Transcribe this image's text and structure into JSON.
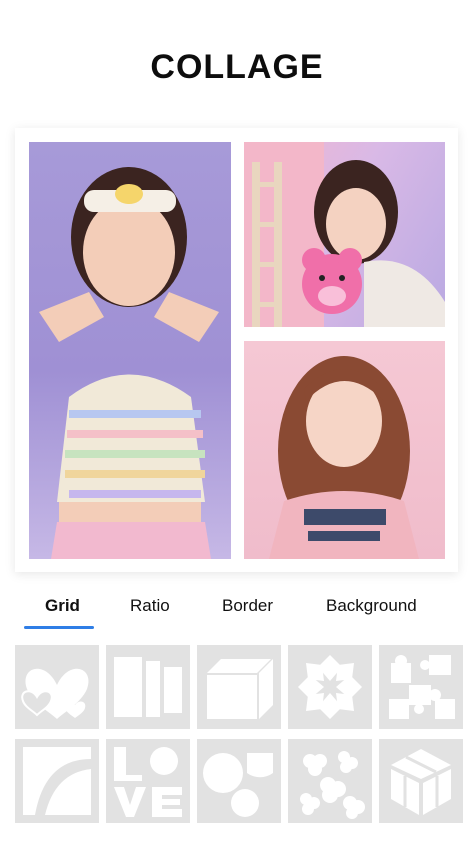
{
  "header": {
    "title": "COLLAGE"
  },
  "collage": {
    "photos": [
      {
        "name": "photo-left"
      },
      {
        "name": "photo-top-right"
      },
      {
        "name": "photo-bottom-right"
      }
    ]
  },
  "tabs": [
    {
      "label": "Grid",
      "active": true
    },
    {
      "label": "Ratio",
      "active": false
    },
    {
      "label": "Border",
      "active": false
    },
    {
      "label": "Background",
      "active": false
    }
  ],
  "accent": "#2f7ee6",
  "layouts": [
    {
      "icon": "heart-layout-icon"
    },
    {
      "icon": "rectangles-layout-icon"
    },
    {
      "icon": "cube-layout-icon"
    },
    {
      "icon": "flower-layout-icon"
    },
    {
      "icon": "puzzle-layout-icon"
    },
    {
      "icon": "curves-layout-icon"
    },
    {
      "icon": "love-letters-layout-icon"
    },
    {
      "icon": "circles-layout-icon"
    },
    {
      "icon": "clover-layout-icon"
    },
    {
      "icon": "hexagon-cube-layout-icon"
    }
  ]
}
